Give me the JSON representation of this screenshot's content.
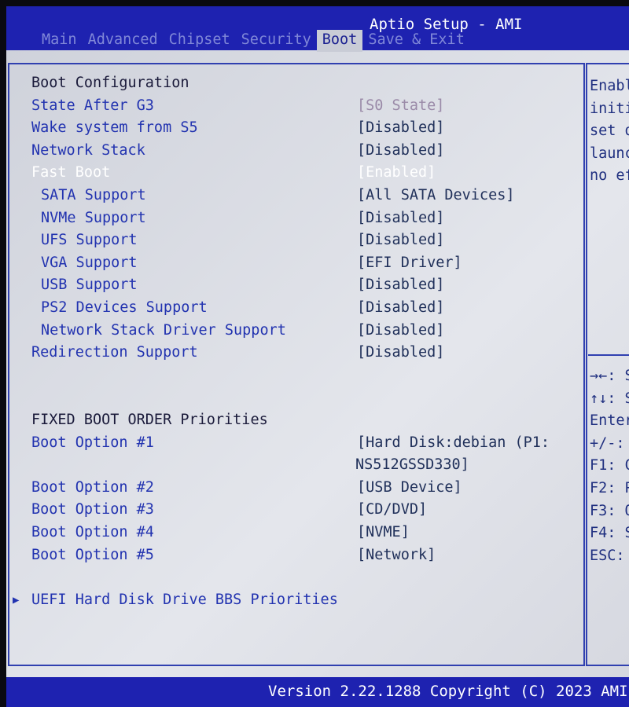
{
  "header": {
    "title": "Aptio Setup - AMI",
    "tabs": [
      "Main",
      "Advanced",
      "Chipset",
      "Security",
      "Boot",
      "Save & Exit"
    ],
    "active_tab": "Boot"
  },
  "main": {
    "rows": [
      {
        "line": 0,
        "label": "Boot Configuration",
        "type": "head"
      },
      {
        "line": 1,
        "label": "State After G3",
        "value": "[S0 State]",
        "dim": true
      },
      {
        "line": 2,
        "label": "Wake system from S5",
        "value": "[Disabled]"
      },
      {
        "line": 3,
        "label": "Network Stack",
        "value": "[Disabled]"
      },
      {
        "line": 4,
        "label": "Fast Boot",
        "value": "[Enabled]",
        "selected": true
      },
      {
        "line": 5,
        "label": "SATA Support",
        "value": "[All SATA Devices]",
        "indent": true
      },
      {
        "line": 6,
        "label": "NVMe Support",
        "value": "[Disabled]",
        "indent": true
      },
      {
        "line": 7,
        "label": "UFS Support",
        "value": "[Disabled]",
        "indent": true
      },
      {
        "line": 8,
        "label": "VGA Support",
        "value": "[EFI Driver]",
        "indent": true
      },
      {
        "line": 9,
        "label": "USB Support",
        "value": "[Disabled]",
        "indent": true
      },
      {
        "line": 10,
        "label": "PS2 Devices Support",
        "value": "[Disabled]",
        "indent": true
      },
      {
        "line": 11,
        "label": "Network Stack Driver Support",
        "value": "[Disabled]",
        "indent": true
      },
      {
        "line": 12,
        "label": "Redirection Support",
        "value": "[Disabled]"
      },
      {
        "line": 15,
        "label": "FIXED BOOT ORDER Priorities",
        "type": "head"
      },
      {
        "line": 16,
        "label": "Boot Option #1",
        "value": "[Hard Disk:debian (P1:"
      },
      {
        "line": 17,
        "label": "",
        "value": "NS512GSSD330]"
      },
      {
        "line": 18,
        "label": "Boot Option #2",
        "value": "[USB Device]"
      },
      {
        "line": 19,
        "label": "Boot Option #3",
        "value": "[CD/DVD]"
      },
      {
        "line": 20,
        "label": "Boot Option #4",
        "value": "[NVME]"
      },
      {
        "line": 21,
        "label": "Boot Option #5",
        "value": "[Network]"
      },
      {
        "line": 23,
        "label": "UEFI Hard Disk Drive BBS Priorities",
        "submenu": true
      }
    ]
  },
  "help": {
    "description": [
      "Enabl",
      "initi",
      "set o",
      "launc",
      "no ef"
    ],
    "keys": [
      "→←: S",
      "↑↓: S",
      "Enter",
      "+/-: ",
      "F1: C",
      "F2: P",
      "F3: O",
      "F4: S",
      "ESC: "
    ]
  },
  "footer": {
    "version": "Version 2.22.1288 Copyright (C) 2023 AMI"
  },
  "colors": {
    "header_bg": "#1e22b0",
    "panel_bg": "#d6d8e0",
    "label": "#2233b0",
    "selected": "#ffffff"
  }
}
